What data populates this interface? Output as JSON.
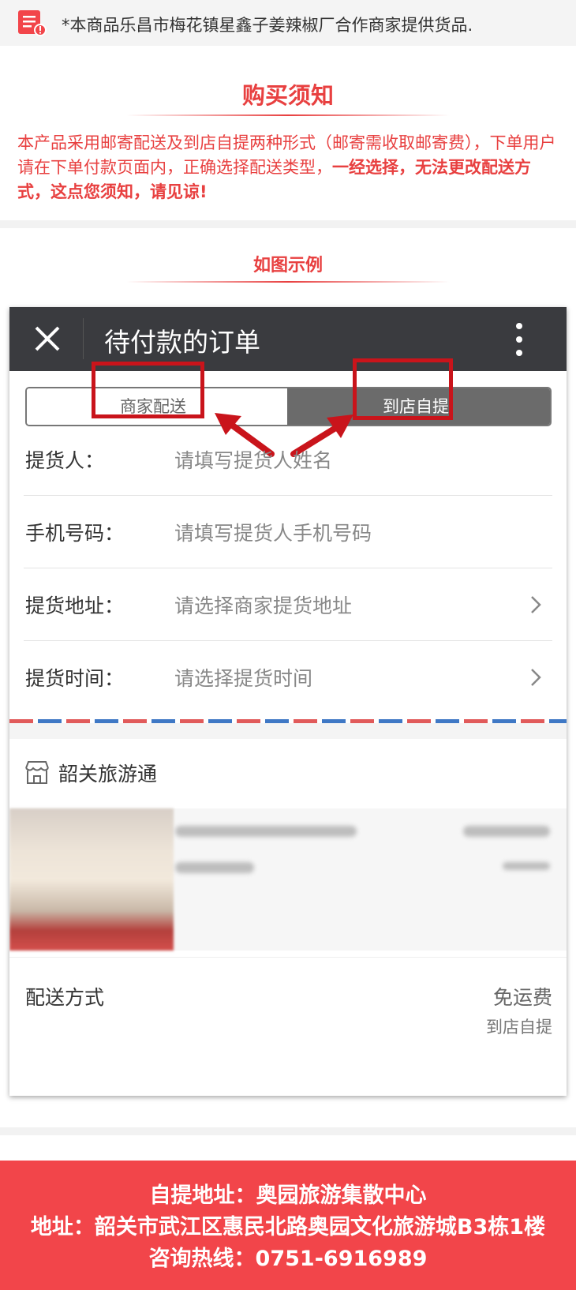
{
  "notice": {
    "text": "*本商品乐昌市梅花镇星鑫子姜辣椒厂合作商家提供货品."
  },
  "purchase_notes": {
    "title": "购买须知",
    "body_normal": "本产品采用邮寄配送及到店自提两种形式（邮寄需收取邮寄费），下单用户请在下单付款页面内，正确选择配送类型，",
    "body_bold": "一经选择，无法更改配送方式，这点您须知，请见谅!"
  },
  "example": {
    "title": "如图示例"
  },
  "phone": {
    "header_title": "待付款的订单",
    "toggle": {
      "left_label": "商家配送",
      "right_label": "到店自提"
    },
    "form": [
      {
        "label": "提货人：",
        "placeholder": "请填写提货人姓名",
        "has_chevron": false
      },
      {
        "label": "手机号码：",
        "placeholder": "请填写提货人手机号码",
        "has_chevron": false
      },
      {
        "label": "提货地址：",
        "placeholder": "请选择商家提货地址",
        "has_chevron": true
      },
      {
        "label": "提货时间：",
        "placeholder": "请选择提货时间",
        "has_chevron": true
      }
    ],
    "shop_name": "韶关旅游通",
    "shipping": {
      "label": "配送方式",
      "fee": "免运费",
      "method": "到店自提"
    }
  },
  "footer": {
    "line1": "自提地址：奥园旅游集散中心",
    "line2": "地址：韶关市武江区惠民北路奥园文化旅游城B3栋1楼",
    "line3": "咨询热线：0751-6916989"
  },
  "colors": {
    "accent_red": "#e84040",
    "footer_red": "#f2454a",
    "header_dark": "#3a3b3f"
  }
}
